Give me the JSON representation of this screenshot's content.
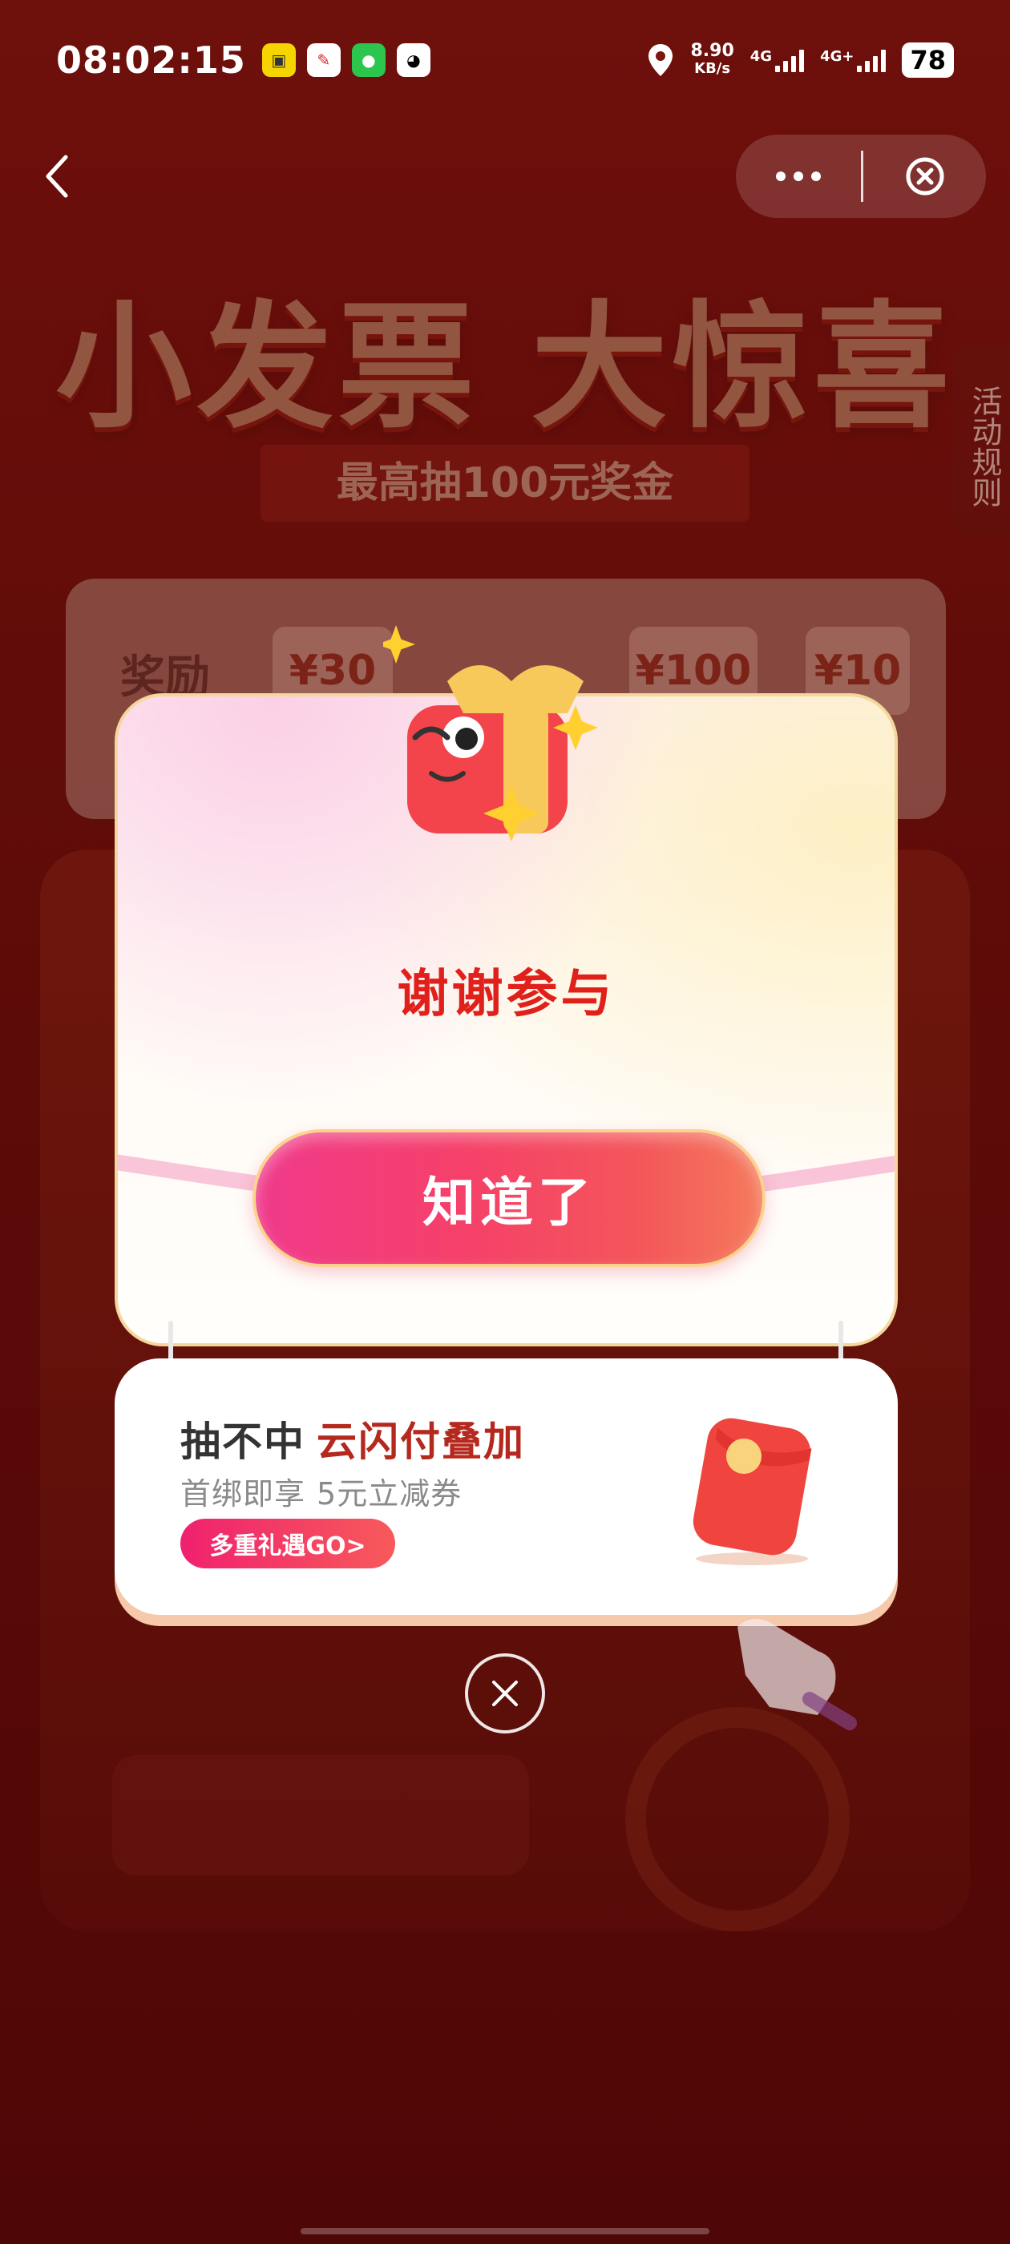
{
  "status_bar": {
    "time": "08:02:15",
    "net_speed_value": "8.90",
    "net_speed_unit": "KB/s",
    "sim1": "4G",
    "sim2": "4G+",
    "battery": "78"
  },
  "page": {
    "title": "小发票 大惊喜",
    "subtitle": "最高抽100元奖金",
    "rules_tab": "活动规则",
    "reward_label": "奖励",
    "reward_chips": [
      "¥30",
      "¥100",
      "¥10"
    ]
  },
  "popup": {
    "message": "谢谢参与",
    "ok_button": "知道了"
  },
  "promo": {
    "title_plain": "抽不中",
    "title_accent": "云闪付叠加",
    "subtitle_plain": "首绑即享",
    "subtitle_highlight": "5元立减券",
    "button": "多重礼遇GO>"
  },
  "colors": {
    "background": "#7c1510",
    "message_red": "#e0201b",
    "button_pink": "#f03a8b",
    "promo_accent": "#b5281d"
  },
  "icons": [
    "back-icon",
    "more-icon",
    "close-miniapp-icon",
    "gift-mascot-icon",
    "red-envelope-icon",
    "close-icon",
    "location-icon"
  ]
}
